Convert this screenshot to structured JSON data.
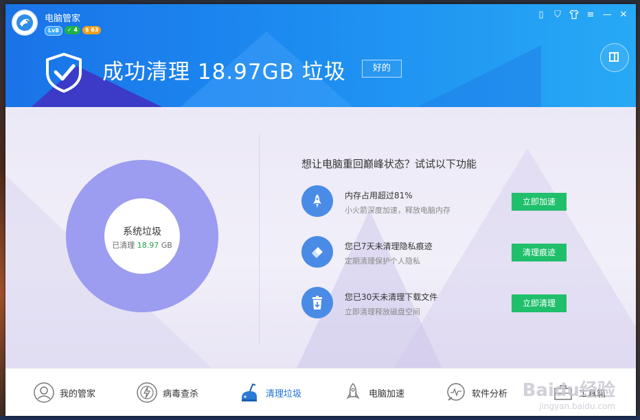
{
  "app": {
    "title": "电脑管家",
    "badges": {
      "level": "Lv8",
      "check": "✓ 4",
      "coins": "$ 63"
    }
  },
  "titlebar": {
    "icons": [
      "phone-icon",
      "shield-icon",
      "shirt-icon",
      "menu-icon",
      "minimize-icon",
      "close-icon"
    ],
    "glyphs": {
      "phone": "▯",
      "shield": "⛉",
      "shirt": "👕",
      "menu": "≡",
      "minimize": "—",
      "close": "✕"
    }
  },
  "header": {
    "headline": "成功清理 18.97GB 垃圾",
    "ok_button": "好的"
  },
  "summary": {
    "title": "系统垃圾",
    "cleaned_prefix": "已清理",
    "cleaned_value": "18.97",
    "cleaned_unit": "GB"
  },
  "suggestions": {
    "title": "想让电脑重回巅峰状态？试试以下功能",
    "items": [
      {
        "icon": "rocket-icon",
        "title": "内存占用超过81%",
        "desc": "小火箭深度加速，释放电脑内存",
        "action": "立即加速"
      },
      {
        "icon": "eraser-icon",
        "title": "您已7天未清理隐私痕迹",
        "desc": "定期清理保护个人隐私",
        "action": "清理痕迹"
      },
      {
        "icon": "trash-icon",
        "title": "您已30天未清理下载文件",
        "desc": "立即清理释放磁盘空间",
        "action": "立即清理"
      }
    ]
  },
  "footer": {
    "nav": [
      {
        "icon": "steward-icon",
        "label": "我的管家"
      },
      {
        "icon": "virus-scan-icon",
        "label": "病毒查杀"
      },
      {
        "icon": "cleanup-icon",
        "label": "清理垃圾",
        "active": true
      },
      {
        "icon": "speedup-icon",
        "label": "电脑加速"
      },
      {
        "icon": "software-icon",
        "label": "软件分析"
      },
      {
        "icon": "toolbox-icon",
        "label": "工具箱"
      }
    ]
  },
  "watermark": {
    "brand": "Baidu经验",
    "url": "jingyan.baidu.com"
  },
  "colors": {
    "header_start": "#1a73e8",
    "header_end": "#27a9f5",
    "donut": "#9c9cf0",
    "action_button": "#1fbf6b",
    "icon_circle": "#4a8be6",
    "active_nav": "#1a6fd6"
  }
}
